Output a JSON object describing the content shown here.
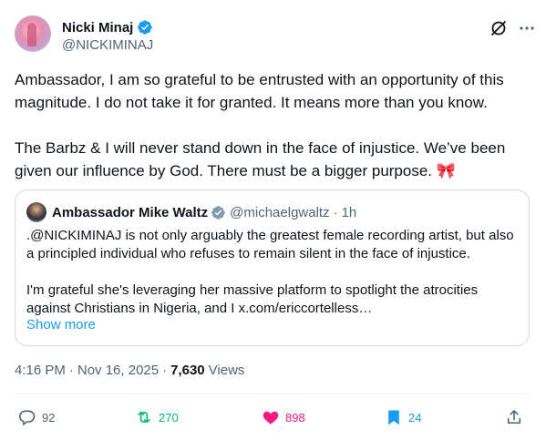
{
  "author": {
    "display_name": "Nicki Minaj",
    "handle": "@NICKIMINAJ",
    "verified": true
  },
  "tweet": {
    "text": "Ambassador, I am so grateful to be entrusted with an opportunity of this magnitude. I do not take it for granted. It means more than you know.\n\nThe Barbz & I will never stand down in the face of injustice. We’ve been given our influence by God. There must be a bigger purpose. 🎀",
    "time": "4:16 PM",
    "date": "Nov 16, 2025",
    "views_count": "7,630",
    "views_label": "Views"
  },
  "quote": {
    "display_name": "Ambassador Mike Waltz",
    "handle": "@michaelgwaltz",
    "age": "1h",
    "text": ".@NICKIMINAJ is not only arguably the greatest female recording artist, but also a principled individual who refuses to remain silent in the face of injustice.\n\nI'm grateful she's leveraging her massive platform to spotlight the atrocities against Christians in Nigeria, and I x.com/ericcortelless…",
    "show_more": "Show more"
  },
  "actions": {
    "replies": "92",
    "reposts": "270",
    "likes": "898",
    "bookmarks": "24"
  },
  "icons": {
    "verified": "verified-badge-icon",
    "grok": "grok-icon",
    "more": "more-dots-icon",
    "reply": "reply-icon",
    "repost": "repost-icon",
    "like": "heart-icon",
    "bookmark": "bookmark-icon",
    "share": "share-icon"
  },
  "colors": {
    "accent": "#1d9bf0",
    "repost_active": "#00ba7c",
    "like_active": "#f91880",
    "secondary_text": "#536471",
    "border": "#cfd9de"
  }
}
